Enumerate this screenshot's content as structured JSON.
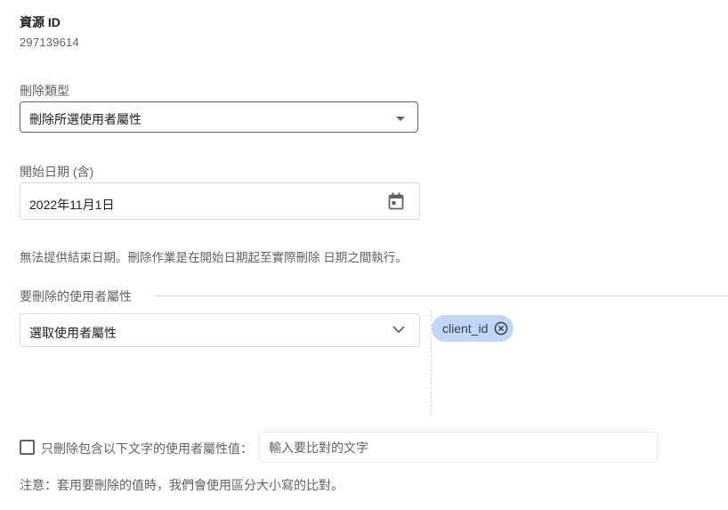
{
  "resource": {
    "label": "資源 ID",
    "value": "297139614"
  },
  "deletion_type": {
    "label": "刪除類型",
    "selected": "刪除所選使用者屬性"
  },
  "start_date": {
    "label": "開始日期 (含)",
    "value": "2022年11月1日"
  },
  "info": "無法提供結束日期。刪除作業是在開始日期起至實際刪除 日期之間執行。",
  "user_properties": {
    "section_title": "要刪除的使用者屬性",
    "picker_placeholder": "選取使用者屬性",
    "chips": [
      "client_id"
    ]
  },
  "filter": {
    "checkbox_label": "只刪除包含以下文字的使用者屬性值：",
    "input_placeholder": "輸入要比對的文字"
  },
  "note": "注意：套用要刪除的值時，我們會使用區分大小寫的比對。",
  "colors": {
    "chip_bg": "#c2d7f7",
    "text_secondary": "#5f6368",
    "border": "#dadce0"
  }
}
